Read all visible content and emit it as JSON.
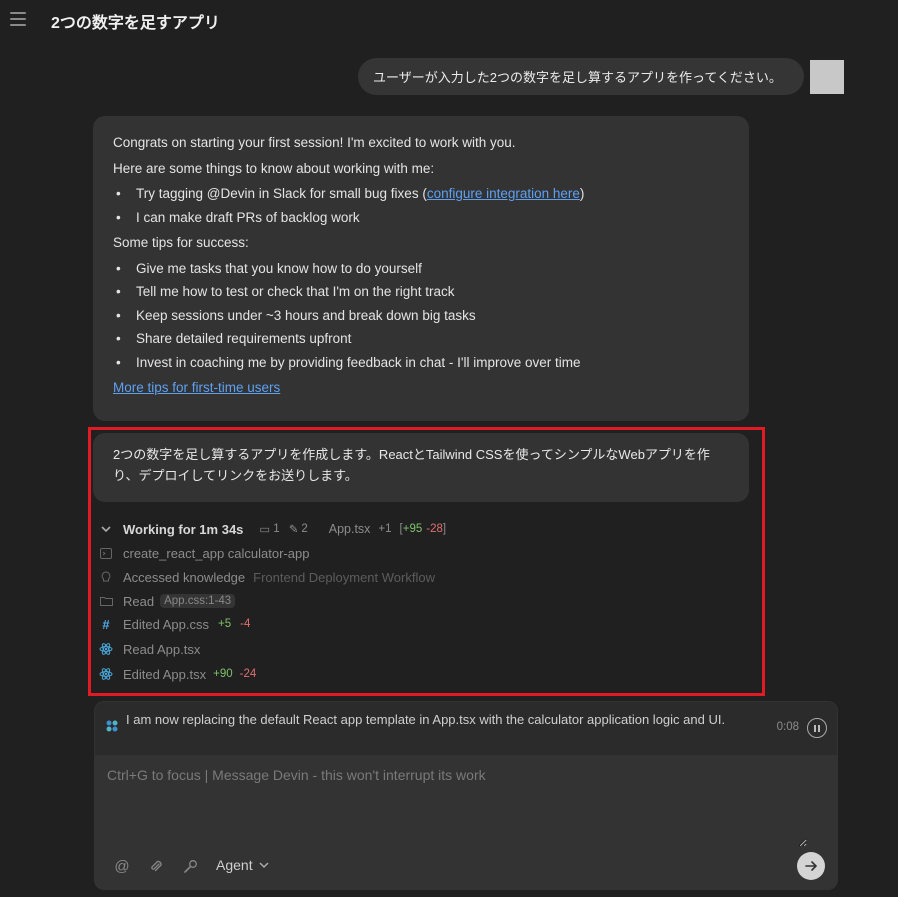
{
  "header": {
    "title": "2つの数字を足すアプリ"
  },
  "user_message": "ユーザーが入力した2つの数字を足し算するアプリを作ってください。",
  "intro": {
    "p1": "Congrats on starting your first session! I'm excited to work with you.",
    "p2": "Here are some things to know about working with me:",
    "bullet1_pre": "Try tagging @Devin in Slack for small bug fixes (",
    "bullet1_link": "configure integration here",
    "bullet1_post": ")",
    "bullet2": "I can make draft PRs of backlog work",
    "p3": "Some tips for success:",
    "tips": [
      "Give me tasks that you know how to do yourself",
      "Tell me how to test or check that I'm on the right track",
      "Keep sessions under ~3 hours and break down big tasks",
      "Share detailed requirements upfront",
      "Invest in coaching me by providing feedback in chat - I'll improve over time"
    ],
    "more_link": "More tips for first-time users"
  },
  "reply": "2つの数字を足し算するアプリを作成します。ReactとTailwind CSSを使ってシンプルなWebアプリを作り、デプロイしてリンクをお送りします。",
  "working": {
    "label": "Working for 1m 34s",
    "msg_count": "1",
    "edit_count": "2",
    "file": "App.tsx",
    "file_extra": "+1",
    "bracket_open": "[",
    "plus": "+95",
    "minus": "-28",
    "bracket_close": "]"
  },
  "steps": {
    "s1": "create_react_app calculator-app",
    "s2_label": "Accessed knowledge",
    "s2_detail": "Frontend Deployment Workflow",
    "s3_label": "Read",
    "s3_chip": "App.css:1-43",
    "s4_label": "Edited App.css",
    "s4_plus": "+5",
    "s4_minus": "-4",
    "s5_label": "Read App.tsx",
    "s6_label": "Edited App.tsx",
    "s6_plus": "+90",
    "s6_minus": "-24"
  },
  "status": {
    "text": "I am now replacing the default React app template in App.tsx with the calculator application logic and UI.",
    "time": "0:08"
  },
  "composer": {
    "placeholder": "Ctrl+G to focus | Message Devin - this won't interrupt its work",
    "mode": "Agent"
  },
  "colors": {
    "accent_red": "#e01b24",
    "link": "#5ea1f2",
    "plus": "#7fc36b",
    "minus": "#e07070"
  }
}
